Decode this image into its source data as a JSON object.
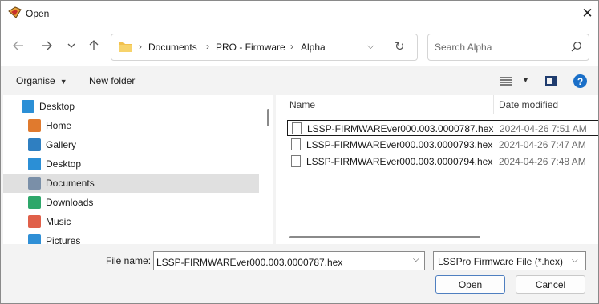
{
  "window": {
    "title": "Open",
    "close_symbol": "✕"
  },
  "nav": {
    "back_icon": "arrow-left-icon",
    "forward_icon": "arrow-right-icon",
    "recent_icon": "chevron-down-icon",
    "up_icon": "arrow-up-icon",
    "breadcrumb": [
      "Documents",
      "PRO - Firmware",
      "Alpha"
    ],
    "search_placeholder": "Search Alpha"
  },
  "toolbar": {
    "organise": "Organise",
    "new_folder": "New folder"
  },
  "tree": [
    {
      "label": "Desktop",
      "icon": "desktop-icon",
      "color": "#2b8fd6",
      "indent": 0,
      "selected": false
    },
    {
      "label": "Home",
      "icon": "home-icon",
      "color": "#e07a2e",
      "indent": 1,
      "selected": false
    },
    {
      "label": "Gallery",
      "icon": "gallery-icon",
      "color": "#2f7fc1",
      "indent": 1,
      "selected": false
    },
    {
      "label": "Desktop",
      "icon": "desktop-icon",
      "color": "#2b8fd6",
      "indent": 1,
      "selected": false
    },
    {
      "label": "Documents",
      "icon": "documents-icon",
      "color": "#7a8fa8",
      "indent": 1,
      "selected": true
    },
    {
      "label": "Downloads",
      "icon": "downloads-icon",
      "color": "#2ea76a",
      "indent": 1,
      "selected": false
    },
    {
      "label": "Music",
      "icon": "music-icon",
      "color": "#e0604a",
      "indent": 1,
      "selected": false
    },
    {
      "label": "Pictures",
      "icon": "pictures-icon",
      "color": "#2f8fd6",
      "indent": 1,
      "selected": false
    }
  ],
  "columns": {
    "name": "Name",
    "date": "Date modified"
  },
  "files": [
    {
      "name": "LSSP-FIRMWAREver000.003.0000787.hex",
      "date": "2024-04-26 7:51 AM",
      "focused": true
    },
    {
      "name": "LSSP-FIRMWAREver000.003.0000793.hex",
      "date": "2024-04-26 7:47 AM",
      "focused": false
    },
    {
      "name": "LSSP-FIRMWAREver000.003.0000794.hex",
      "date": "2024-04-26 7:48 AM",
      "focused": false
    }
  ],
  "footer": {
    "file_name_label": "File name:",
    "file_name_value": "LSSP-FIRMWAREver000.003.0000787.hex",
    "file_type": "LSSPro Firmware File (*.hex)",
    "open": "Open",
    "cancel": "Cancel"
  }
}
